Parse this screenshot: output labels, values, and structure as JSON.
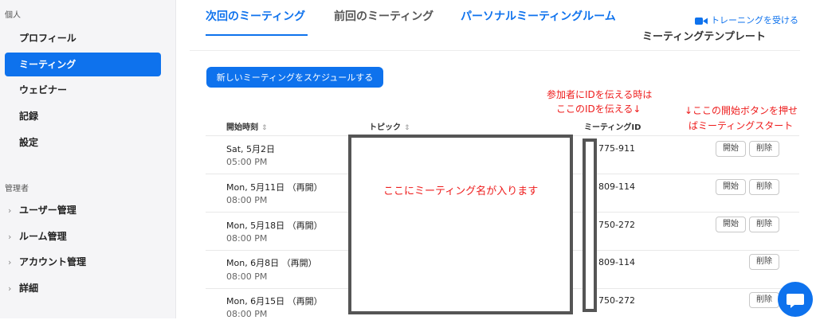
{
  "sidebar": {
    "personal_header": "個人",
    "items": [
      "プロフィール",
      "ミーティング",
      "ウェビナー",
      "記録",
      "設定"
    ],
    "admin_header": "管理者",
    "admin_items": [
      "ユーザー管理",
      "ルーム管理",
      "アカウント管理",
      "詳細"
    ]
  },
  "tabs": [
    "次回のミーティング",
    "前回のミーティング",
    "パーソナルミーティングルーム"
  ],
  "training_link": "トレーニングを受ける",
  "template_link": "ミーティングテンプレート",
  "schedule_button": "新しいミーティングをスケジュールする",
  "columns": {
    "start_time": "開始時刻",
    "topic": "トピック",
    "meeting_id": "ミーティングID"
  },
  "rows": [
    {
      "date": "Sat, 5月2日",
      "time": "05:00 PM",
      "id": "775-911",
      "start": "開始",
      "delete": "削除"
    },
    {
      "date": "Mon, 5月11日 （再開）",
      "time": "08:00 PM",
      "id": "809-114",
      "start": "開始",
      "delete": "削除"
    },
    {
      "date": "Mon, 5月18日 （再開）",
      "time": "08:00 PM",
      "id": "750-272",
      "start": "開始",
      "delete": "削除"
    },
    {
      "date": "Mon, 6月8日 （再開）",
      "time": "08:00 PM",
      "id": "809-114",
      "delete": "削除"
    },
    {
      "date": "Mon, 6月15日 （再開）",
      "time": "08:00 PM",
      "id": "750-272",
      "delete": "削除"
    }
  ],
  "annotations": {
    "topic_note": "ここにミーティング名が入ります",
    "id_note_line1": "参加者にIDを伝える時は",
    "id_note_line2": "ここのIDを伝える↓",
    "start_note_line1": "↓ここの開始ボタンを押せ",
    "start_note_line2": "ばミーティングスタート"
  },
  "colors": {
    "accent": "#0e72ed",
    "annotation": "#ee1c1c"
  }
}
